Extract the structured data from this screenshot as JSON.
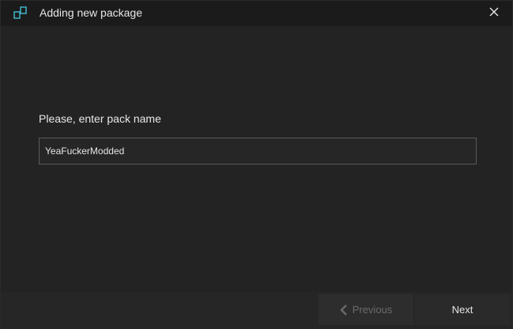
{
  "window": {
    "title": "Adding new package",
    "app_icon": "package-icon",
    "close_icon": "close-icon"
  },
  "form": {
    "prompt": "Please, enter pack name",
    "pack_name_value": "YeaFuckerModded",
    "pack_name_placeholder": ""
  },
  "footer": {
    "previous_label": "Previous",
    "previous_icon": "chevron-left-icon",
    "next_label": "Next"
  },
  "colors": {
    "accent": "#3fb5c8",
    "caret": "#f0a030",
    "background": "#232323"
  }
}
